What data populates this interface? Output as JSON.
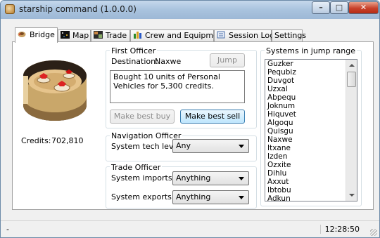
{
  "window": {
    "title": "starship command (1.0.0.0)"
  },
  "tabs": [
    {
      "label": "Bridge",
      "icon": "bridge-icon"
    },
    {
      "label": "Map",
      "icon": "map-icon"
    },
    {
      "label": "Trade",
      "icon": "trade-icon"
    },
    {
      "label": "Crew and Equipment",
      "icon": "crew-icon"
    },
    {
      "label": "Session Log",
      "icon": "log-icon"
    },
    {
      "label": "Settings"
    }
  ],
  "bridge": {
    "credits_label": "Credits:",
    "credits_value": "702,810"
  },
  "first_officer": {
    "title": "First Officer",
    "destination_label": "Destination:",
    "destination_value": "Naxwe",
    "jump_label": "Jump",
    "message": "Bought 10 units of Personal Vehicles for 5,300 credits.",
    "best_buy_label": "Make best buy",
    "best_sell_label": "Make best sell"
  },
  "navigation_officer": {
    "title": "Navigation Officer",
    "tech_label": "System tech level:",
    "tech_value": "Any"
  },
  "trade_officer": {
    "title": "Trade Officer",
    "imports_label": "System imports:",
    "imports_value": "Anything",
    "exports_label": "System exports:",
    "exports_value": "Anything"
  },
  "systems": {
    "title": "Systems in jump range",
    "items": [
      "Guzker",
      "Pequbiz",
      "Duvgot",
      "Uzxal",
      "Abpequ",
      "Joknum",
      "Hiquvet",
      "Algoqu",
      "Quisgu",
      "Naxwe",
      "Itxane",
      "Izden",
      "Ozxite",
      "Dihlu",
      "Axxut",
      "Ibtobu",
      "Adkun"
    ]
  },
  "status": {
    "left": "-",
    "time": "12:28:50"
  }
}
